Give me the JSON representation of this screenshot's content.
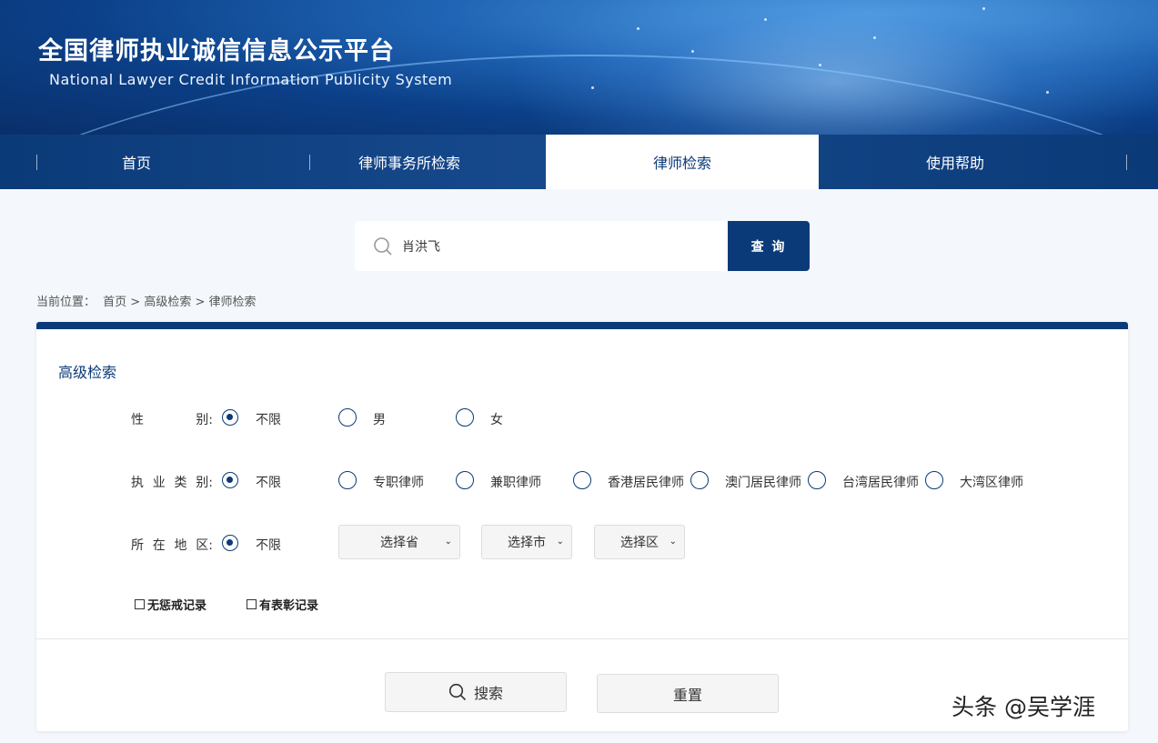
{
  "header": {
    "title": "全国律师执业诚信信息公示平台",
    "subtitle": "National Lawyer Credit Information Publicity System"
  },
  "nav": {
    "items": [
      {
        "label": "首页",
        "active": false
      },
      {
        "label": "律师事务所检索",
        "active": false
      },
      {
        "label": "律师检索",
        "active": true
      },
      {
        "label": "使用帮助",
        "active": false
      }
    ]
  },
  "search": {
    "value": "肖洪飞",
    "button_label": "查 询",
    "icon": "search-icon"
  },
  "breadcrumb": {
    "prefix": "当前位置：",
    "path": "首页 > 高级检索 > 律师检索"
  },
  "advanced": {
    "title": "高级检索",
    "gender": {
      "label_parts": [
        "性",
        "别:"
      ],
      "options": [
        "不限",
        "男",
        "女"
      ],
      "selected": "不限"
    },
    "practice_type": {
      "label_parts": [
        "执",
        "业",
        "类",
        "别:"
      ],
      "options": [
        "不限",
        "专职律师",
        "兼职律师",
        "香港居民律师",
        "澳门居民律师",
        "台湾居民律师",
        "大湾区律师"
      ],
      "selected": "不限"
    },
    "region": {
      "label_parts": [
        "所",
        "在",
        "地",
        "区:"
      ],
      "options": [
        "不限"
      ],
      "selected": "不限",
      "province_placeholder": "选择省",
      "city_placeholder": "选择市",
      "district_placeholder": "选择区"
    },
    "checkboxes": [
      {
        "label": "无惩戒记录",
        "checked": false
      },
      {
        "label": "有表彰记录",
        "checked": false
      }
    ],
    "search_button": "搜索",
    "reset_button": "重置"
  },
  "watermark": "头条 @吴学涯",
  "colors": {
    "primary": "#0b3a78",
    "background": "#f4f7fb"
  }
}
